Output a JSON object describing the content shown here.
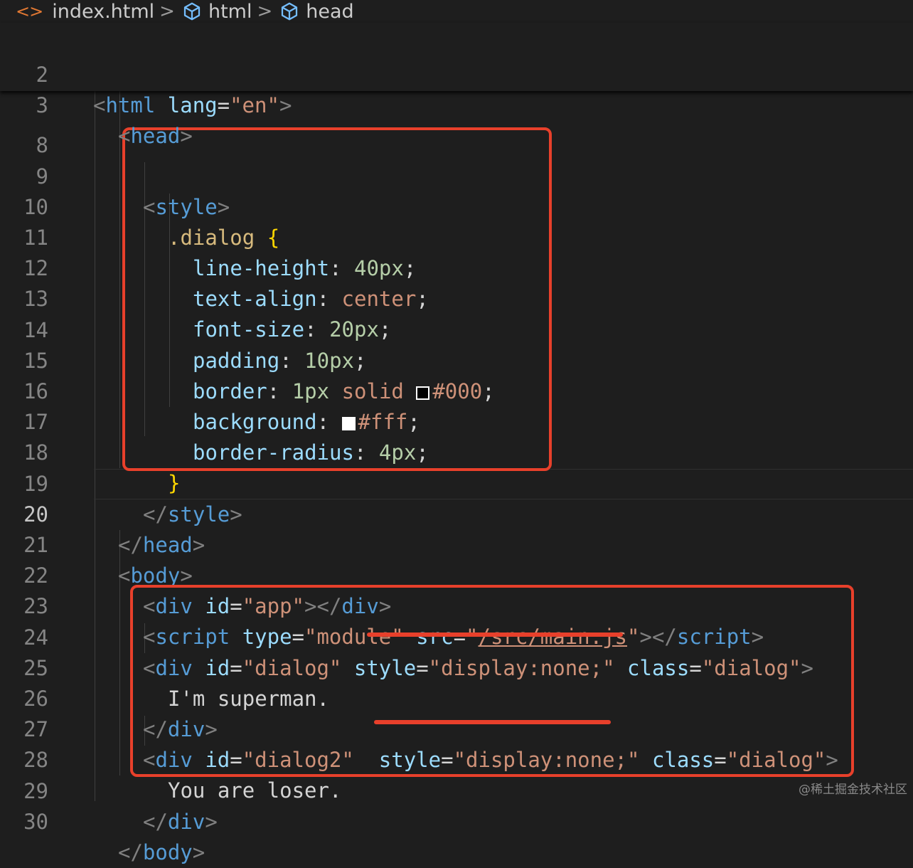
{
  "breadcrumb": {
    "file_icon": "<>",
    "file": "index.html",
    "sep": ">",
    "items": [
      "html",
      "head"
    ]
  },
  "sticky": [
    {
      "num": "2",
      "code": {
        "open": "<",
        "tag": "html",
        "attr": "lang",
        "eq": "=",
        "val": "\"en\"",
        "close": ">"
      }
    },
    {
      "num": "3",
      "code": {
        "open": "<",
        "tag": "head",
        "close": ">"
      }
    }
  ],
  "lines": {
    "l8": {
      "num": "8"
    },
    "l9": {
      "num": "9",
      "open": "<",
      "tag": "style",
      "close": ">"
    },
    "l10": {
      "num": "10",
      "selector": ".dialog",
      "brace": "{"
    },
    "l11": {
      "num": "11",
      "prop": "line-height",
      "colon": ":",
      "value": "40px",
      "semi": ";"
    },
    "l12": {
      "num": "12",
      "prop": "text-align",
      "colon": ":",
      "value": "center",
      "semi": ";"
    },
    "l13": {
      "num": "13",
      "prop": "font-size",
      "colon": ":",
      "value": "20px",
      "semi": ";"
    },
    "l14": {
      "num": "14",
      "prop": "padding",
      "colon": ":",
      "value": "10px",
      "semi": ";"
    },
    "l15": {
      "num": "15",
      "prop": "border",
      "colon": ":",
      "value_a": "1px",
      "value_b": "solid",
      "color": "#000",
      "semi": ";"
    },
    "l16": {
      "num": "16",
      "prop": "background",
      "colon": ":",
      "color": "#fff",
      "semi": ";"
    },
    "l17": {
      "num": "17",
      "prop": "border-radius",
      "colon": ":",
      "value": "4px",
      "semi": ";"
    },
    "l18": {
      "num": "18",
      "brace": "}"
    },
    "l19": {
      "num": "19",
      "open": "</",
      "tag": "style",
      "close": ">"
    },
    "l20": {
      "num": "20",
      "open": "</",
      "tag": "head",
      "close": ">"
    },
    "l21": {
      "num": "21",
      "open": "<",
      "tag": "body",
      "close": ">"
    },
    "l22": {
      "num": "22",
      "open": "<",
      "tag": "div",
      "attr": "id",
      "eq": "=",
      "val": "\"app\"",
      "mid": "></",
      "tag2": "div",
      "close": ">"
    },
    "l23": {
      "num": "23",
      "open": "<",
      "tag": "script",
      "attr1": "type",
      "eq": "=",
      "val1": "\"module\"",
      "attr2": "src",
      "q1": "\"",
      "path": "/src/main.js",
      "q2": "\"",
      "mid": "></",
      "tag2": "script",
      "close": ">"
    },
    "l24": {
      "num": "24",
      "open": "<",
      "tag": "div",
      "attr1": "id",
      "eq": "=",
      "val1": "\"dialog\"",
      "attr2": "style",
      "val2": "\"display:none;\"",
      "attr3": "class",
      "val3": "\"dialog\"",
      "close": ">"
    },
    "l25": {
      "num": "25",
      "text": "I'm superman."
    },
    "l26": {
      "num": "26",
      "open": "</",
      "tag": "div",
      "close": ">"
    },
    "l27": {
      "num": "27",
      "open": "<",
      "tag": "div",
      "attr1": "id",
      "eq": "=",
      "val1": "\"dialog2\"",
      "attr2": "style",
      "val2": "\"display:none;\"",
      "attr3": "class",
      "val3": "\"dialog\"",
      "close": ">"
    },
    "l28": {
      "num": "28",
      "text": "You are loser."
    },
    "l29": {
      "num": "29",
      "open": "</",
      "tag": "div",
      "close": ">"
    },
    "l30": {
      "num": "30",
      "open": "</",
      "tag": "body",
      "close": ">"
    }
  },
  "colors": {
    "annotation": "#e8402b",
    "background": "#1e1e1e"
  },
  "watermark": "@稀土掘金技术社区"
}
